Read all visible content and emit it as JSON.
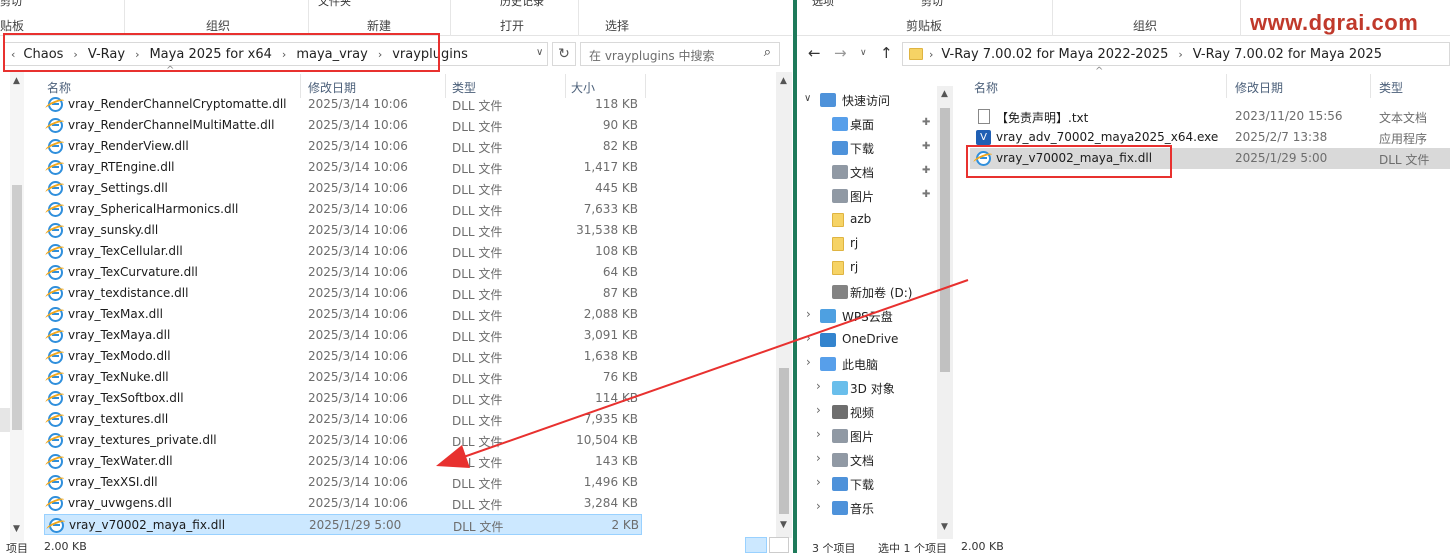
{
  "left": {
    "ribbon": {
      "top": [
        "剪切",
        "文件夹",
        "历史记录"
      ],
      "labels": [
        "贴板",
        "组织",
        "新建",
        "打开",
        "选择"
      ]
    },
    "breadcrumb": [
      "Chaos",
      "V-Ray",
      "Maya 2025 for x64",
      "maya_vray",
      "vrayplugins"
    ],
    "search_placeholder": "在 vrayplugins 中搜索",
    "columns": {
      "name": "名称",
      "date": "修改日期",
      "type": "类型",
      "size": "大小"
    },
    "files": [
      {
        "name": "vray_RenderChannelCryptomatte.dll",
        "date": "2025/3/14 10:06",
        "type": "DLL 文件",
        "size": "118 KB"
      },
      {
        "name": "vray_RenderChannelMultiMatte.dll",
        "date": "2025/3/14 10:06",
        "type": "DLL 文件",
        "size": "90 KB"
      },
      {
        "name": "vray_RenderView.dll",
        "date": "2025/3/14 10:06",
        "type": "DLL 文件",
        "size": "82 KB"
      },
      {
        "name": "vray_RTEngine.dll",
        "date": "2025/3/14 10:06",
        "type": "DLL 文件",
        "size": "1,417 KB"
      },
      {
        "name": "vray_Settings.dll",
        "date": "2025/3/14 10:06",
        "type": "DLL 文件",
        "size": "445 KB"
      },
      {
        "name": "vray_SphericalHarmonics.dll",
        "date": "2025/3/14 10:06",
        "type": "DLL 文件",
        "size": "7,633 KB"
      },
      {
        "name": "vray_sunsky.dll",
        "date": "2025/3/14 10:06",
        "type": "DLL 文件",
        "size": "31,538 KB"
      },
      {
        "name": "vray_TexCellular.dll",
        "date": "2025/3/14 10:06",
        "type": "DLL 文件",
        "size": "108 KB"
      },
      {
        "name": "vray_TexCurvature.dll",
        "date": "2025/3/14 10:06",
        "type": "DLL 文件",
        "size": "64 KB"
      },
      {
        "name": "vray_texdistance.dll",
        "date": "2025/3/14 10:06",
        "type": "DLL 文件",
        "size": "87 KB"
      },
      {
        "name": "vray_TexMax.dll",
        "date": "2025/3/14 10:06",
        "type": "DLL 文件",
        "size": "2,088 KB"
      },
      {
        "name": "vray_TexMaya.dll",
        "date": "2025/3/14 10:06",
        "type": "DLL 文件",
        "size": "3,091 KB"
      },
      {
        "name": "vray_TexModo.dll",
        "date": "2025/3/14 10:06",
        "type": "DLL 文件",
        "size": "1,638 KB"
      },
      {
        "name": "vray_TexNuke.dll",
        "date": "2025/3/14 10:06",
        "type": "DLL 文件",
        "size": "76 KB"
      },
      {
        "name": "vray_TexSoftbox.dll",
        "date": "2025/3/14 10:06",
        "type": "DLL 文件",
        "size": "114 KB"
      },
      {
        "name": "vray_textures.dll",
        "date": "2025/3/14 10:06",
        "type": "DLL 文件",
        "size": "7,935 KB"
      },
      {
        "name": "vray_textures_private.dll",
        "date": "2025/3/14 10:06",
        "type": "DLL 文件",
        "size": "10,504 KB"
      },
      {
        "name": "vray_TexWater.dll",
        "date": "2025/3/14 10:06",
        "type": "DLL 文件",
        "size": "143 KB"
      },
      {
        "name": "vray_TexXSI.dll",
        "date": "2025/3/14 10:06",
        "type": "DLL 文件",
        "size": "1,496 KB"
      },
      {
        "name": "vray_uvwgens.dll",
        "date": "2025/3/14 10:06",
        "type": "DLL 文件",
        "size": "3,284 KB"
      },
      {
        "name": "vray_v70002_maya_fix.dll",
        "date": "2025/1/29 5:00",
        "type": "DLL 文件",
        "size": "2 KB"
      }
    ],
    "status": {
      "count": "项目",
      "size": "2.00 KB"
    }
  },
  "right": {
    "ribbon": {
      "top": [
        "选项",
        "剪切"
      ],
      "labels": [
        "剪贴板",
        "组织"
      ]
    },
    "watermark": "www.dgrai.com",
    "breadcrumb": [
      "V-Ray 7.00.02 for Maya 2022-2025",
      "V-Ray 7.00.02 for Maya 2025"
    ],
    "columns": {
      "name": "名称",
      "date": "修改日期",
      "type": "类型"
    },
    "nav": [
      {
        "label": "快速访问",
        "icon": "star-icon",
        "level": 0
      },
      {
        "label": "桌面",
        "icon": "desktop-icon",
        "level": 1,
        "pinned": true
      },
      {
        "label": "下载",
        "icon": "download-icon",
        "level": 1,
        "pinned": true
      },
      {
        "label": "文档",
        "icon": "document-icon",
        "level": 1,
        "pinned": true
      },
      {
        "label": "图片",
        "icon": "picture-icon",
        "level": 1,
        "pinned": true
      },
      {
        "label": "azb",
        "icon": "folder-icon",
        "level": 1
      },
      {
        "label": "rj",
        "icon": "folder-icon",
        "level": 1
      },
      {
        "label": "rj",
        "icon": "folder-icon",
        "level": 1
      },
      {
        "label": "新加卷 (D:)",
        "icon": "drive-icon",
        "level": 1
      },
      {
        "label": "WPS云盘",
        "icon": "cloud-icon",
        "level": 0
      },
      {
        "label": "OneDrive",
        "icon": "onedrive-icon",
        "level": 0
      },
      {
        "label": "此电脑",
        "icon": "computer-icon",
        "level": 0
      },
      {
        "label": "3D 对象",
        "icon": "3d-icon",
        "level": 1
      },
      {
        "label": "视频",
        "icon": "video-icon",
        "level": 1
      },
      {
        "label": "图片",
        "icon": "picture-icon",
        "level": 1
      },
      {
        "label": "文档",
        "icon": "document-icon",
        "level": 1
      },
      {
        "label": "下载",
        "icon": "download-icon",
        "level": 1
      },
      {
        "label": "音乐",
        "icon": "music-icon",
        "level": 1
      }
    ],
    "files": [
      {
        "name": "【免责声明】.txt",
        "date": "2023/11/20 15:56",
        "type": "文本文档",
        "icon": "txt-icon"
      },
      {
        "name": "vray_adv_70002_maya2025_x64.exe",
        "date": "2025/2/7 13:38",
        "type": "应用程序",
        "icon": "vray-exe-icon"
      },
      {
        "name": "vray_v70002_maya_fix.dll",
        "date": "2025/1/29 5:00",
        "type": "DLL 文件",
        "icon": "dll-icon"
      }
    ],
    "status": {
      "count": "3 个项目",
      "selected": "选中 1 个项目",
      "size": "2.00 KB"
    }
  },
  "colors": {
    "accent_red": "#e8312f",
    "selection": "#cce8ff",
    "header_text": "#4c607a",
    "divider": "#1e7a5a"
  }
}
